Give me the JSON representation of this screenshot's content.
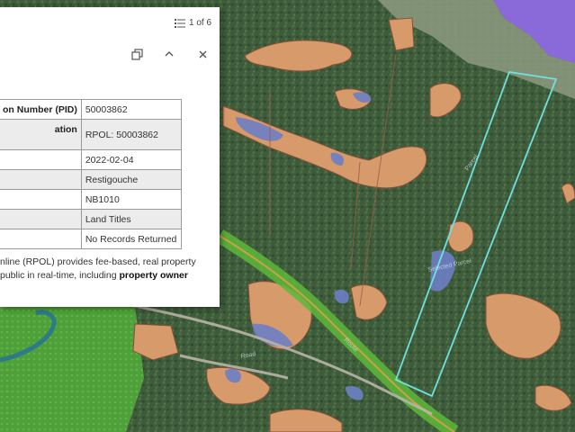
{
  "popup": {
    "pager": "1 of 6",
    "rows": [
      {
        "key": "on Number (PID)",
        "value": ""
      },
      {
        "key": "ation",
        "value": ""
      },
      {
        "key": "",
        "value": "2022-02-04"
      },
      {
        "key": "",
        "value": "Restigouche"
      },
      {
        "key": "",
        "value": "NB1010"
      },
      {
        "key": "",
        "value": "Land Titles"
      },
      {
        "key": "",
        "value": "No Records Returned"
      }
    ],
    "pid_value": "50003862",
    "link_label": "RPOL: 50003862",
    "description_line1": "nline (RPOL) provides fee-based, real property",
    "description_line2": "public in real-time, including ",
    "description_bold": "property owner"
  },
  "colors": {
    "forest": "#3e5c3b",
    "parcel_fill": "#d79a6a",
    "water": "#6d7fc4",
    "highway": "#5db83a",
    "parcel_outline": "#6fe0e0",
    "sea": "#8a6ad8"
  }
}
